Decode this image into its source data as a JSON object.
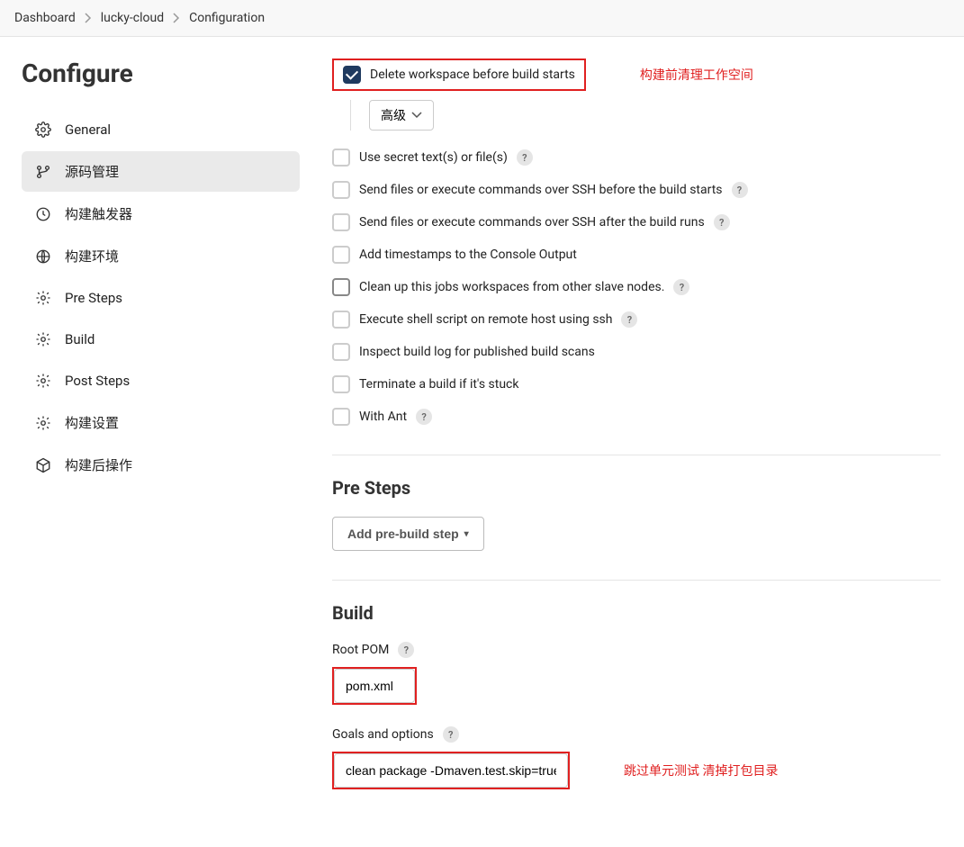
{
  "breadcrumb": [
    "Dashboard",
    "lucky-cloud",
    "Configuration"
  ],
  "page_title": "Configure",
  "sidebar": {
    "items": [
      {
        "label": "General"
      },
      {
        "label": "源码管理"
      },
      {
        "label": "构建触发器"
      },
      {
        "label": "构建环境"
      },
      {
        "label": "Pre Steps"
      },
      {
        "label": "Build"
      },
      {
        "label": "Post Steps"
      },
      {
        "label": "构建设置"
      },
      {
        "label": "构建后操作"
      }
    ]
  },
  "env": {
    "delete_ws": "Delete workspace before build starts",
    "annotation_delete": "构建前清理工作空间",
    "advanced": "高级",
    "opts": [
      {
        "label": "Use secret text(s) or file(s)",
        "help": true
      },
      {
        "label": "Send files or execute commands over SSH before the build starts",
        "help": true
      },
      {
        "label": "Send files or execute commands over SSH after the build runs",
        "help": true
      },
      {
        "label": "Add timestamps to the Console Output",
        "help": false
      },
      {
        "label": "Clean up this jobs workspaces from other slave nodes.",
        "help": true,
        "highlight": true
      },
      {
        "label": "Execute shell script on remote host using ssh",
        "help": true
      },
      {
        "label": "Inspect build log for published build scans",
        "help": false
      },
      {
        "label": "Terminate a build if it's stuck",
        "help": false
      },
      {
        "label": "With Ant",
        "help": true
      }
    ]
  },
  "pre_steps": {
    "title": "Pre Steps",
    "button": "Add pre-build step"
  },
  "build": {
    "title": "Build",
    "root_pom_label": "Root POM",
    "root_pom_value": "pom.xml",
    "goals_label": "Goals and options",
    "goals_value": "clean package -Dmaven.test.skip=true",
    "annotation_goals": "跳过单元测试 清掉打包目录"
  }
}
